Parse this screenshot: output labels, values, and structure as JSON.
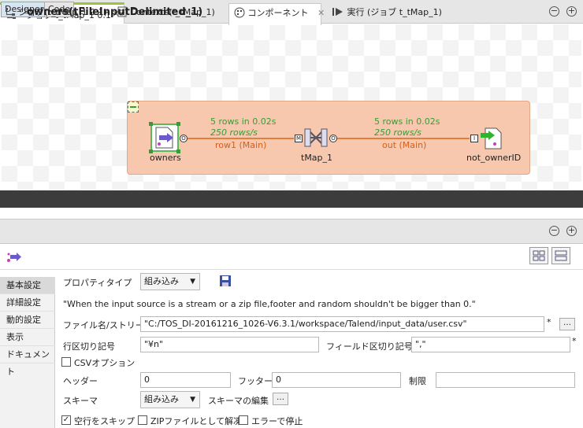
{
  "editor_tab": {
    "title": "*ジョブ t_tMap_1 0.1",
    "close": "×"
  },
  "window_buttons": {
    "minimize": "−",
    "maximize": "+"
  },
  "canvas": {
    "components": [
      {
        "name": "owners"
      },
      {
        "name": "tMap_1"
      },
      {
        "name": "not_ownerID"
      }
    ],
    "connections": [
      {
        "rows": "5 rows in 0.02s",
        "rate": "250 rows/s",
        "label": "row1 (Main)"
      },
      {
        "rows": "5 rows in 0.02s",
        "rate": "250 rows/s",
        "label": "out (Main)"
      }
    ],
    "ports": {
      "o1": "O",
      "m": "M",
      "o2": "O",
      "i": "I"
    }
  },
  "view_tabs": {
    "designer": "Designer",
    "code": "Code"
  },
  "bottom_tabs": {
    "job": "ジョブ(t_tMap_1 0.1)",
    "contexts": "Contexts(t_tMap_1)",
    "component": "コンポーネント",
    "run": "実行 (ジョブ t_tMap_1)"
  },
  "component_title": "owners(tFileInputDelimited_1)",
  "sidebar": [
    "基本設定",
    "詳細設定",
    "動的設定",
    "表示",
    "ドキュメント"
  ],
  "form": {
    "property_type_label": "プロパティタイプ",
    "property_type_value": "組み込み",
    "warning": "\"When the input source is a stream or a zip file,footer and random shouldn't be bigger than 0.\"",
    "filename_label": "ファイル名/ストリーム",
    "filename_value": "\"C:/TOS_DI-20161216_1026-V6.3.1/workspace/Talend/input_data/user.csv\"",
    "row_sep_label": "行区切り記号",
    "row_sep_value": "\"¥n\"",
    "field_sep_label": "フィールド区切り記号",
    "field_sep_value": "\",\"",
    "csv_label": "CSVオプション",
    "header_label": "ヘッダー",
    "header_value": "0",
    "footer_label": "フッター",
    "footer_value": "0",
    "limit_label": "制限",
    "limit_value": "",
    "schema_label": "スキーマ",
    "schema_value": "組み込み",
    "schema_edit_label": "スキーマの編集",
    "skip_empty_label": "空行をスキップ",
    "unzip_label": "ZIPファイルとして解凍",
    "stop_on_error_label": "エラーで停止",
    "star": "*",
    "ellipsis": "…",
    "check": "✓"
  }
}
